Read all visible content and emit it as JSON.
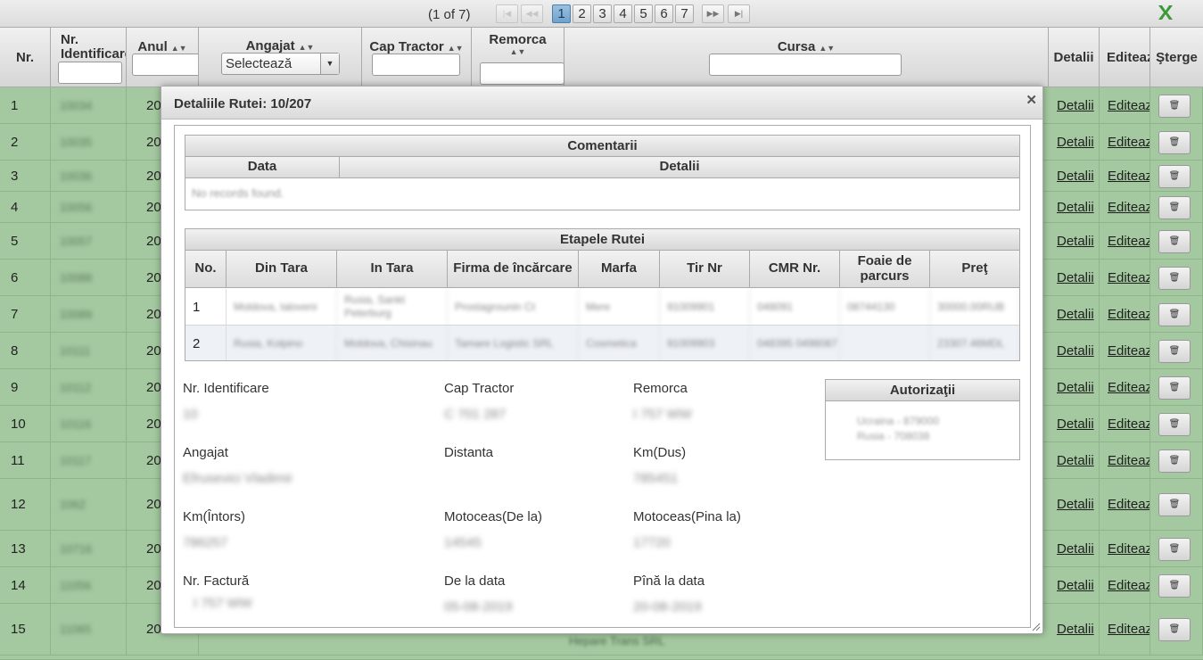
{
  "paginator": {
    "current_text": "(1 of 7)",
    "first_icon": "first-page-icon",
    "prev_icon": "prev-page-icon",
    "next_icon": "next-page-icon",
    "last_icon": "last-page-icon",
    "pages": [
      "1",
      "2",
      "3",
      "4",
      "5",
      "6",
      "7"
    ],
    "active_page": "1",
    "export_icon": "excel-export-icon"
  },
  "table": {
    "columns": {
      "nr": "Nr.",
      "id": "Nr. Identificare",
      "anul": "Anul",
      "angajat": "Angajat",
      "cap_tractor": "Cap Tractor",
      "remorca": "Remorca",
      "cursa": "Cursa",
      "detalii": "Detalii",
      "editeaza": "Editează",
      "sterge": "Şterge"
    },
    "angajat_select": "Selectează",
    "detail_link": "Detalii",
    "edit_link": "Editează",
    "delete_icon": "trash-icon",
    "rows": [
      {
        "nr": "1",
        "id": "10034",
        "anul": "20"
      },
      {
        "nr": "2",
        "id": "10035",
        "anul": "20"
      },
      {
        "nr": "3",
        "id": "10036",
        "anul": "20"
      },
      {
        "nr": "4",
        "id": "10056",
        "anul": "20"
      },
      {
        "nr": "5",
        "id": "10057",
        "anul": "20"
      },
      {
        "nr": "6",
        "id": "10088",
        "anul": "20"
      },
      {
        "nr": "7",
        "id": "10089",
        "anul": "20"
      },
      {
        "nr": "8",
        "id": "10111",
        "anul": "20"
      },
      {
        "nr": "9",
        "id": "10112",
        "anul": "20"
      },
      {
        "nr": "10",
        "id": "10116",
        "anul": "20"
      },
      {
        "nr": "11",
        "id": "10117",
        "anul": "20"
      },
      {
        "nr": "12",
        "id": "1062",
        "anul": "20"
      },
      {
        "nr": "13",
        "id": "10716",
        "anul": "20"
      },
      {
        "nr": "14",
        "id": "11056",
        "anul": "20"
      },
      {
        "nr": "15",
        "id": "11065",
        "anul": "20"
      }
    ],
    "row15_cursa_fragment": "Hepare Trans SRL"
  },
  "dialog": {
    "title": "Detaliile Rutei: 10/207",
    "close_icon": "close-icon",
    "comments": {
      "title": "Comentarii",
      "col_data": "Data",
      "col_detalii": "Detalii",
      "empty": "No records found."
    },
    "stages": {
      "title": "Etapele Rutei",
      "columns": [
        "No.",
        "Din Tara",
        "In Tara",
        "Firma de încărcare",
        "Marfa",
        "Tir Nr",
        "CMR Nr.",
        "Foaie de parcurs",
        "Preţ"
      ],
      "rows": [
        [
          "1",
          "Moldova, Ialoveni",
          "Rusia, Sankt Peterburg",
          "Prostagrounin Ct",
          "Mere",
          "91009901",
          "048091",
          "08744130",
          "30000.00RUB"
        ],
        [
          "2",
          "Rusia, Kolpino",
          "Moldova, Chisinau",
          "Tamare Logistic SRL",
          "Cosmetica",
          "91009903",
          "048395 0498087",
          "",
          "23307.46MDL"
        ]
      ]
    },
    "fields": {
      "nr_identificare": {
        "label": "Nr. Identificare",
        "value": "10"
      },
      "cap_tractor": {
        "label": "Cap Tractor",
        "value": "C 701 287"
      },
      "remorca": {
        "label": "Remorca",
        "value": "I 757 WW"
      },
      "angajat": {
        "label": "Angajat",
        "value": "Efrusevici Vladimir"
      },
      "distanta": {
        "label": "Distanta",
        "value": ""
      },
      "km_dus": {
        "label": "Km(Dus)",
        "value": "785451"
      },
      "km_intors": {
        "label": "Km(Întors)",
        "value": "786257"
      },
      "motoceas_de_la": {
        "label": "Motoceas(De la)",
        "value": "14545"
      },
      "motoceas_pina_la": {
        "label": "Motoceas(Pina la)",
        "value": "17720"
      },
      "nr_factura": {
        "label": "Nr. Factură",
        "value": "I 757 WW"
      },
      "de_la_data": {
        "label": "De la data",
        "value": "05-08-2019"
      },
      "pina_la_data": {
        "label": "Pînă la data",
        "value": "20-08-2019"
      }
    },
    "autorizatii": {
      "title": "Autorizaţii",
      "lines": [
        "Ucraina - 879000",
        "Rusia - 708038"
      ]
    }
  }
}
